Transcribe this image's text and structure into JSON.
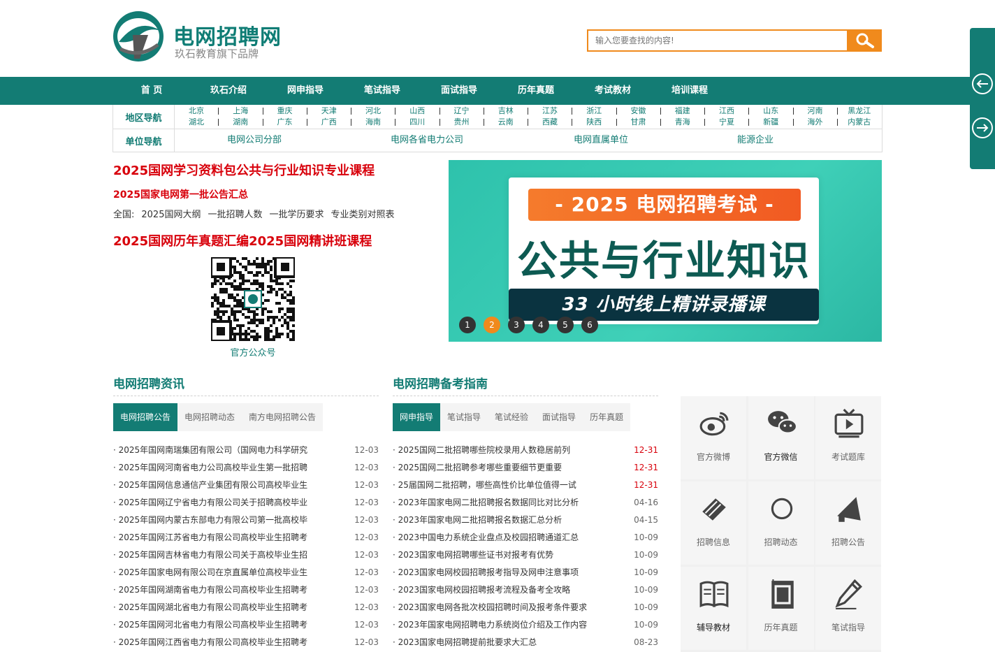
{
  "header": {
    "site_title": "电网招聘网",
    "site_subtitle": "玖石教育旗下品牌",
    "search_placeholder": "输入您要查找的内容!"
  },
  "colors": {
    "brand": "#137c74",
    "accent": "#f08a1c",
    "highlight": "#d8000b"
  },
  "nav": [
    "首 页",
    "玖石介绍",
    "网申指导",
    "笔试指导",
    "面试指导",
    "历年真题",
    "考试教材",
    "培训课程"
  ],
  "region_nav": {
    "label": "地区导航",
    "row1": [
      "北京",
      "上海",
      "重庆",
      "天津",
      "河北",
      "山西",
      "辽宁",
      "吉林",
      "江苏",
      "浙江",
      "安徽",
      "福建",
      "江西",
      "山东",
      "河南",
      "黑龙江"
    ],
    "row2": [
      "湖北",
      "湖南",
      "广东",
      "广西",
      "海南",
      "四川",
      "贵州",
      "云南",
      "西藏",
      "陕西",
      "甘肃",
      "青海",
      "宁夏",
      "新疆",
      "海外",
      "内蒙古"
    ]
  },
  "unit_nav": {
    "label": "单位导航",
    "items": [
      "电网公司分部",
      "电网各省电力公司",
      "电网直属单位",
      "能源企业"
    ]
  },
  "promo": {
    "line1": [
      "2025国网学习资料包",
      "公共与行业知识专业课程"
    ],
    "line2": "2025国家电网第一批公告汇总",
    "line3": [
      "全国:",
      "2025国网大纲",
      "一批招聘人数",
      "一批学历要求",
      "专业类别对照表"
    ],
    "line4": [
      "2025国网历年真题汇编",
      "2025国网精讲班课程"
    ],
    "qr_caption": "官方公众号"
  },
  "banner": {
    "top": "- 2025 电网招聘考试 -",
    "main": "公共与行业知识",
    "bottom": "33 小时线上精讲录播课",
    "dots": [
      "1",
      "2",
      "3",
      "4",
      "5",
      "6"
    ],
    "active_dot": 1
  },
  "news": {
    "title": "电网招聘资讯",
    "tabs": [
      "电网招聘公告",
      "电网招聘动态",
      "南方电网招聘公告"
    ],
    "items": [
      {
        "t": "· 2025年国网南瑞集团有限公司（国网电力科学研究",
        "d": "12-03"
      },
      {
        "t": "· 2025年国网河南省电力公司高校毕业生第一批招聘",
        "d": "12-03"
      },
      {
        "t": "· 2025年国网信息通信产业集团有限公司高校毕业生",
        "d": "12-03"
      },
      {
        "t": "· 2025年国网辽宁省电力有限公司关于招聘高校毕业",
        "d": "12-03"
      },
      {
        "t": "· 2025年国网内蒙古东部电力有限公司第一批高校毕",
        "d": "12-03"
      },
      {
        "t": "· 2025年国网江苏省电力有限公司高校毕业生招聘考",
        "d": "12-03"
      },
      {
        "t": "· 2025年国网吉林省电力有限公司关于高校毕业生招",
        "d": "12-03"
      },
      {
        "t": "· 2025年国家电网有限公司在京直属单位高校毕业生",
        "d": "12-03"
      },
      {
        "t": "· 2025年国网湖南省电力有限公司高校毕业生招聘考",
        "d": "12-03"
      },
      {
        "t": "· 2025年国网湖北省电力有限公司高校毕业生招聘考",
        "d": "12-03"
      },
      {
        "t": "· 2025年国网河北省电力有限公司高校毕业生招聘考",
        "d": "12-03"
      },
      {
        "t": "· 2025年国网江西省电力有限公司高校毕业生招聘考",
        "d": "12-03"
      }
    ]
  },
  "guide": {
    "title": "电网招聘备考指南",
    "tabs": [
      "网申指导",
      "笔试指导",
      "笔试经验",
      "面试指导",
      "历年真题"
    ],
    "items": [
      {
        "t": "· 2025国网二批招聘哪些院校录用人数稳居前列",
        "d": "12-31",
        "hot": true
      },
      {
        "t": "· 2025国网二批招聘参考哪些重要细节更重要",
        "d": "12-31",
        "hot": true
      },
      {
        "t": "· 25届国网二批招聘，哪些高性价比单位值得一试",
        "d": "12-31",
        "hot": true
      },
      {
        "t": "· 2023年国家电网二批招聘报名数据同比对比分析",
        "d": "04-16",
        "hot": false
      },
      {
        "t": "· 2023年国家电网二批招聘报名数据汇总分析",
        "d": "04-15",
        "hot": false
      },
      {
        "t": "· 2023中国电力系统企业盘点及校园招聘通道汇总",
        "d": "10-09",
        "hot": false
      },
      {
        "t": "· 2023国家电网招聘哪些证书对报考有优势",
        "d": "10-09",
        "hot": false
      },
      {
        "t": "· 2023国家电网校园招聘报考指导及网申注意事项",
        "d": "10-09",
        "hot": false
      },
      {
        "t": "· 2023国家电网校园招聘报考流程及备考全攻略",
        "d": "10-09",
        "hot": false
      },
      {
        "t": "· 2023国家电网各批次校园招聘时间及报考条件要求",
        "d": "10-09",
        "hot": false
      },
      {
        "t": "· 2023年国家电网招聘电力系统岗位介绍及工作内容",
        "d": "10-09",
        "hot": false
      },
      {
        "t": "· 2023国家电网招聘提前批要求大汇总",
        "d": "08-23",
        "hot": false
      }
    ]
  },
  "icon_grid": [
    {
      "label": "官方微博",
      "icon": "weibo-icon"
    },
    {
      "label": "官方微信",
      "icon": "wechat-icon"
    },
    {
      "label": "考试题库",
      "icon": "tv-icon"
    },
    {
      "label": "招聘信息",
      "icon": "eraser-icon"
    },
    {
      "label": "招聘动态",
      "icon": "compass-icon"
    },
    {
      "label": "招聘公告",
      "icon": "megaphone-icon"
    },
    {
      "label": "辅导教材",
      "icon": "book-icon"
    },
    {
      "label": "历年真题",
      "icon": "notebook-icon"
    },
    {
      "label": "笔试指导",
      "icon": "pencil-icon"
    }
  ]
}
